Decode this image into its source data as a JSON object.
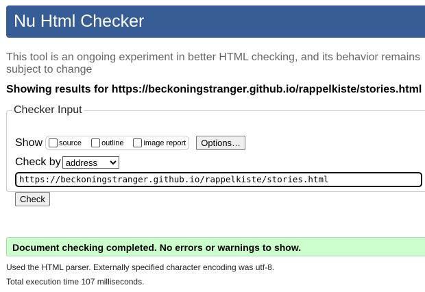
{
  "header": {
    "title": "Nu Html Checker"
  },
  "intro": "This tool is an ongoing experiment in better HTML checking, and its behavior remains subject to change",
  "showing": "Showing results for https://beckoningstranger.github.io/rappelkiste/stories.html",
  "form": {
    "legend": "Checker Input",
    "show_label": "Show",
    "options": [
      {
        "label": "source",
        "checked": false
      },
      {
        "label": "outline",
        "checked": false
      },
      {
        "label": "image report",
        "checked": false
      }
    ],
    "options_button": "Options…",
    "check_by_label": "Check by",
    "check_by_value": "address",
    "url": "https://beckoningstranger.github.io/rappelkiste/stories.html",
    "check_button": "Check"
  },
  "result": {
    "message": "Document checking completed. No errors or warnings to show."
  },
  "details": [
    "Used the HTML parser. Externally specified character encoding was utf-8.",
    "Total execution time 107 milliseconds."
  ]
}
